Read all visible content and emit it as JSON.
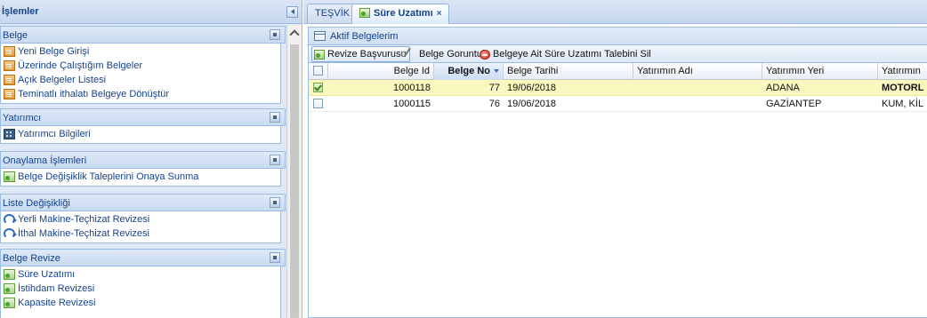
{
  "left_panel": {
    "title": "İşlemler",
    "sections": [
      {
        "title": "Belge",
        "items": [
          {
            "label": "Yeni Belge Girişi",
            "icon": "document-icon"
          },
          {
            "label": "Üzerinde Çalıştığım Belgeler",
            "icon": "document-icon"
          },
          {
            "label": "Açık Belgeler Listesi",
            "icon": "document-icon"
          },
          {
            "label": "Teminatlı ithalatı Belgeye Dönüştür",
            "icon": "document-icon"
          }
        ]
      },
      {
        "title": "Yatırımcı",
        "items": [
          {
            "label": "Yatırımcı Bilgileri",
            "icon": "building-icon"
          }
        ]
      },
      {
        "title": "Onaylama İşlemleri",
        "items": [
          {
            "label": "Belge Değişiklik Taleplerini Onaya Sunma",
            "icon": "page-add-icon"
          }
        ]
      },
      {
        "title": "Liste Değişikliği",
        "items": [
          {
            "label": "Yerli Makine-Teçhizat Revizesi",
            "icon": "redo-icon"
          },
          {
            "label": "İthal Makine-Teçhizat Revizesi",
            "icon": "redo-icon"
          }
        ]
      },
      {
        "title": "Belge Revize",
        "items": [
          {
            "label": "Süre Uzatımı",
            "icon": "page-add-icon"
          },
          {
            "label": "İstihdam Revizesi",
            "icon": "page-add-icon"
          },
          {
            "label": "Kapasite Revizesi",
            "icon": "page-add-icon"
          }
        ]
      }
    ]
  },
  "tabs": [
    {
      "label": "TEŞVİK",
      "active": false
    },
    {
      "label": "Süre Uzatımı",
      "active": true,
      "close": "×"
    }
  ],
  "grid": {
    "title": "Aktif Belgelerim",
    "toolbar": {
      "revize": "Revize Başvurusu",
      "goruntule": "Belge Goruntule",
      "sil": "Belgeye Ait Süre Uzatımı Talebini Sil"
    },
    "columns": [
      "Belge Id",
      "Belge No",
      "Belge Tarihi",
      "Yatırımın Adı",
      "Yatırımın Yeri",
      "Yatırımın"
    ],
    "sorted_column": "Belge No",
    "rows": [
      {
        "checked": true,
        "selected": true,
        "id": "1000118",
        "no": "77",
        "tarih": "19/06/2018",
        "adi": "",
        "yeri": "ADANA",
        "ext": "MOTORL"
      },
      {
        "checked": false,
        "selected": false,
        "id": "1000115",
        "no": "76",
        "tarih": "19/06/2018",
        "adi": "",
        "yeri": "GAZİANTEP",
        "ext": "KUM, KİL"
      }
    ]
  },
  "colors": {
    "panel_bg": "#dfe8f6",
    "header_text": "#15428b",
    "border": "#99bbe8",
    "selected_row": "#fbf8bf"
  }
}
